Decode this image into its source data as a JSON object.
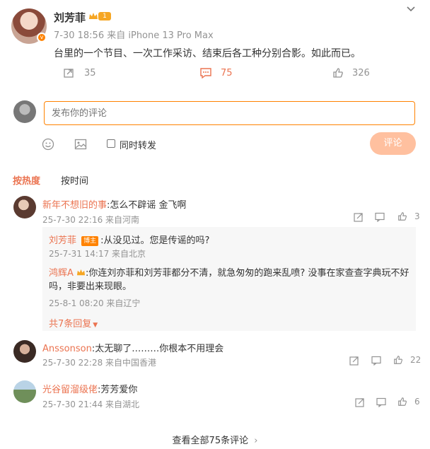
{
  "post": {
    "author": "刘芳菲",
    "meta": "7-30 18:56 来自 iPhone 13 Pro Max",
    "text": "台里的一个节目、一次工作采访、结束后各工种分别合影。如此而已。",
    "reposts": "35",
    "comments": "75",
    "likes": "326",
    "badge_level": "1"
  },
  "composer": {
    "placeholder": "发布你的评论",
    "repost_label": "同时转发",
    "submit_label": "评论"
  },
  "sort": {
    "hot": "按热度",
    "time": "按时间"
  },
  "comments": [
    {
      "user": "新年不想旧的事",
      "text": ":怎么不辟谣 金飞啊",
      "meta": "25-7-30 22:16 来自河南",
      "likes": "3",
      "replies": [
        {
          "user": "刘芳菲",
          "tag": "博主",
          "text": ":从没见过。您是传谣的吗?",
          "meta": "25-7-31 14:17 来自北京"
        },
        {
          "user": "鸿辉A",
          "text": ":你连刘亦菲和刘芳菲都分不清，就急匆匆的跑来乱喷? 没事在家查查字典玩不好吗，非要出来现眼。",
          "meta": "25-8-1 08:20 来自辽宁"
        }
      ],
      "more_replies": "共7条回复"
    },
    {
      "user": "Anssonson",
      "text": ":太无聊了………你根本不用理会",
      "meta": "25-7-30 22:28 来自中国香港",
      "likes": "22"
    },
    {
      "user": "光谷留溜级佬",
      "text": ":芳芳爱你",
      "meta": "25-7-30 21:44 来自湖北",
      "likes": "6"
    }
  ],
  "footer": {
    "view_all": "查看全部75条评论"
  },
  "colors": {
    "accent": "#eb7350",
    "link": "#eb7350",
    "button": "#ffc09f"
  }
}
